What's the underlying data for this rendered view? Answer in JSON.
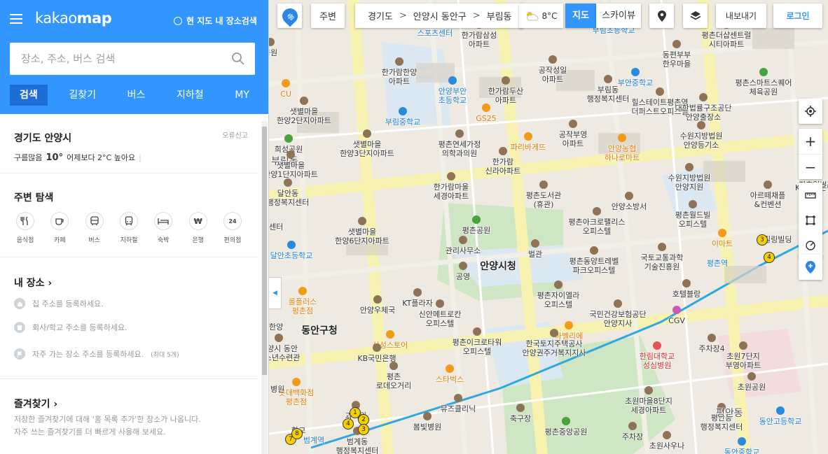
{
  "header": {
    "logo_light": "kakao",
    "logo_bold": "map",
    "nearby_label": "현 지도 내 장소검색",
    "search_placeholder": "장소, 주소, 버스 검색",
    "tabs": [
      {
        "label": "검색",
        "active": true
      },
      {
        "label": "길찾기"
      },
      {
        "label": "버스"
      },
      {
        "label": "지하철"
      },
      {
        "label": "MY"
      }
    ]
  },
  "weather": {
    "location": "경기도 안양시",
    "report_label": "오류신고",
    "condition": "구름많음",
    "temperature": "10°",
    "compare": "어제보다 2°C 높아요",
    "sep": "|"
  },
  "nearby_explore": {
    "title": "주변 탐색",
    "categories": [
      {
        "label": "음식점",
        "icon": "fork-knife-icon"
      },
      {
        "label": "카페",
        "icon": "coffee-icon"
      },
      {
        "label": "버스",
        "icon": "bus-icon"
      },
      {
        "label": "지하철",
        "icon": "subway-icon"
      },
      {
        "label": "숙박",
        "icon": "bed-icon"
      },
      {
        "label": "은행",
        "icon": "won-icon"
      },
      {
        "label": "편의점",
        "icon": "store-24-icon"
      }
    ]
  },
  "my_places": {
    "title": "내 장소",
    "items": [
      {
        "text": "집 주소를 등록하세요."
      },
      {
        "text": "회사/학교 주소를 등록하세요."
      },
      {
        "text": "자주 가는 장소 주소를 등록하세요.",
        "note": "(최대 5개)"
      }
    ]
  },
  "favorites": {
    "title": "즐겨찾기",
    "desc1": "저장한 즐겨찾기에 대해 '홈 목록 추가'한 장소가 나옵니다.",
    "desc2": "자주 쓰는 즐겨찾기를 더 빠르게 사용해 보세요."
  },
  "map_controls": {
    "departure_badge": "출",
    "nearby_button": "주변",
    "breadcrumb": [
      "경기도",
      "안양시 동안구",
      "부림동"
    ],
    "breadcrumb_sep": ">",
    "weather_temp": "8°C",
    "map_type": "지도",
    "skyview": "스카이뷰",
    "export": "내보내기",
    "login": "로그인"
  },
  "map_labels": {
    "districts": [
      "안양동",
      "부림동"
    ],
    "metro": [
      "평촌역",
      "범계역"
    ],
    "places": [
      "스포츠센터",
      "한가람삼성\n아파트",
      "부림초등학교",
      "평촌더샵센트럴\n시티아파트",
      "동편부부\n한우마을",
      "공원",
      "한가람한양\n아파트",
      "공작성일\n아파트",
      "부안중학교",
      "안양부안\n초등학교",
      "한가람두산\n아파트",
      "평촌스마트스퀘어\n체육공원",
      "CU",
      "샛별마을\n한양2단지아파트",
      "부림중학교",
      "GS25",
      "부림동\n행정복지센터",
      "힐스테이트평촌역\n더퍼스트오피스텔",
      "대한법률구조공단\n안양출장소",
      "희성공원",
      "평촌연세가정\n의학과의원",
      "파리바게뜨",
      "공작부영\n아파트",
      "수원지방법원\n안양등기소",
      "샛별마을\n한양3단지아파트",
      "한가람\n신라아파트",
      "안양농협\n하나로마트",
      "샛별마을\n한양1단지아파트",
      "달안동\n행정복지센터",
      "한가람마을\n세경아파트",
      "평촌도서관\n(휴관)",
      "수원지방법원\n안양지원",
      "안양소방서",
      "아르떼채플\n&컨벤션",
      "평촌일번가",
      "센터",
      "평촌공원",
      "평촌아크로팰리스\n오피스텔",
      "평촌월드빌\n오피스텔",
      "샛별마을\n한양6단지아파트",
      "관리사무소",
      "벌관",
      "달안초등학교",
      "이마트",
      "안양시청",
      "평촌동양트레벨\n파크오피스텔",
      "국토교통과학\n기술진흥원",
      "공영",
      "KT플라자",
      "평촌자이엘라\n오피스텔",
      "호텔블랑",
      "롤플러스\n평촌점",
      "안양우체국",
      "국민건강보험공단\n안양지사",
      "신안메트로칸\n오피스텔",
      "마벨리에",
      "CGV",
      "동안구청",
      "삼성스토어",
      "평촌이크로타워\n오피스텔",
      "한국토지주택공사\n안양권주거복지지사",
      "주차장4",
      "안양시 동안\n청소년수련관",
      "KB국민은행",
      "한림대학교\n성심병원",
      "초원7단지\n부영아파트",
      "평촌\n로데오거리",
      "스타벅스",
      "초원공원",
      "롯데백화점\n평촌점",
      "과의원",
      "뮤즈클리닉",
      "초원마을8단지\n세경아파트",
      "봄빛병원",
      "축구장",
      "평촌중앙공원",
      "평안동\n행정복지센터",
      "동안고등학교",
      "범계동\n행정복지센터",
      "주차장",
      "초원사우나",
      "동안중학교",
      "학교",
      "한양",
      "KB국민은행",
      "킬링빌딩",
      "병원",
      "평안동"
    ]
  }
}
